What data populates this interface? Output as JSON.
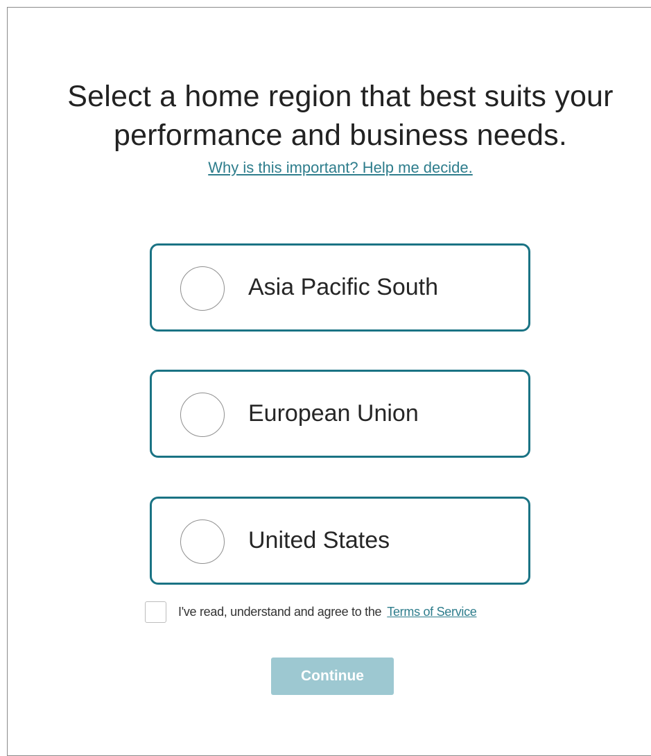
{
  "heading": "Select a home region that best suits your\nperformance and business needs.",
  "help_link": "Why is this important? Help me decide.",
  "regions": [
    {
      "label": "Asia Pacific South",
      "selected": false
    },
    {
      "label": "European Union",
      "selected": false
    },
    {
      "label": "United States",
      "selected": false
    }
  ],
  "agreement": {
    "text": "I've read, understand and agree to the",
    "link": "Terms of Service",
    "checked": false
  },
  "continue": {
    "label": "Continue",
    "enabled": false
  },
  "colors": {
    "accent": "#1a7384",
    "link": "#2e7d8c",
    "button_disabled": "#9dc8d1"
  }
}
